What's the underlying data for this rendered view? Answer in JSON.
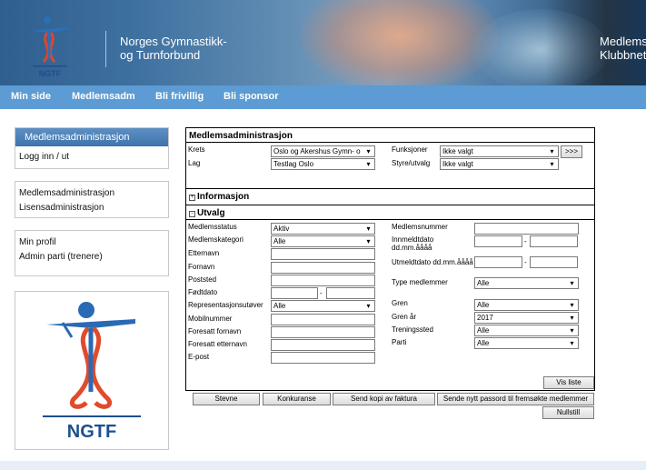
{
  "header": {
    "org_line1": "Norges Gymnastikk-",
    "org_line2": "og Turnforbund",
    "right_line1": "Medlems",
    "right_line2": "Klubbnet",
    "logo_text": "NGTF"
  },
  "nav": {
    "items": [
      "Min side",
      "Medlemsadm",
      "Bli frivillig",
      "Bli sponsor"
    ]
  },
  "sidebar": {
    "box1": {
      "title": "Medlemsadministrasjon",
      "items": [
        "Logg inn / ut"
      ]
    },
    "box2": {
      "items": [
        "Medlemsadministrasjon",
        "Lisensadministrasjon"
      ]
    },
    "box3": {
      "items": [
        "Min profil",
        "Admin parti (trenere)"
      ]
    },
    "logo_text": "NGTF"
  },
  "main": {
    "title": "Medlemsadministrasjon",
    "top": {
      "krets_label": "Krets",
      "krets_value": "Oslo og Akershus Gymn- o",
      "lag_label": "Lag",
      "lag_value": "Testlag Oslo",
      "funksjoner_label": "Funksjoner",
      "funksjoner_value": "Ikke valgt",
      "styre_label": "Styre/utvalg",
      "styre_value": "Ikke valgt",
      "go_button": ">>>"
    },
    "informasjon": {
      "toggle": "+",
      "label": "Informasjon"
    },
    "utvalg": {
      "toggle": "-",
      "label": "Utvalg",
      "left": {
        "medlemsstatus_label": "Medlemsstatus",
        "medlemsstatus_value": "Aktiv",
        "medlemskategori_label": "Medlemskategori",
        "medlemskategori_value": "Alle",
        "etternavn_label": "Etternavn",
        "fornavn_label": "Fornavn",
        "poststed_label": "Poststed",
        "fodtdato_label": "Fødtdato",
        "representasjon_label": "Representasjonsutøver",
        "representasjon_value": "Alle",
        "mobil_label": "Mobilnummer",
        "foresatt_fornavn_label": "Foresatt fornavn",
        "foresatt_etternavn_label": "Foresatt etternavn",
        "epost_label": "E-post"
      },
      "right": {
        "medlemsnummer_label": "Medlemsnummer",
        "innmeldt_label1": "Innmeldtdato",
        "innmeldt_label2": "dd.mm.åååå",
        "utmeldt_label": "Utmeldtdato dd.mm.åååå",
        "type_label": "Type medlemmer",
        "type_value": "Alle",
        "gren_label": "Gren",
        "gren_value": "Alle",
        "gren_ar_label": "Gren år",
        "gren_ar_value": "2017",
        "treningssted_label": "Treningssted",
        "treningssted_value": "Alle",
        "parti_label": "Parti",
        "parti_value": "Alle"
      },
      "dash": "-"
    },
    "buttons": {
      "vis_liste": "Vis liste",
      "stevne": "Stevne",
      "konkuranse": "Konkuranse",
      "send_kopi": "Send kopi av faktura",
      "send_passord": "Sende nytt passord til fremsøkte medlemmer",
      "nullstill": "Nullstill"
    }
  }
}
